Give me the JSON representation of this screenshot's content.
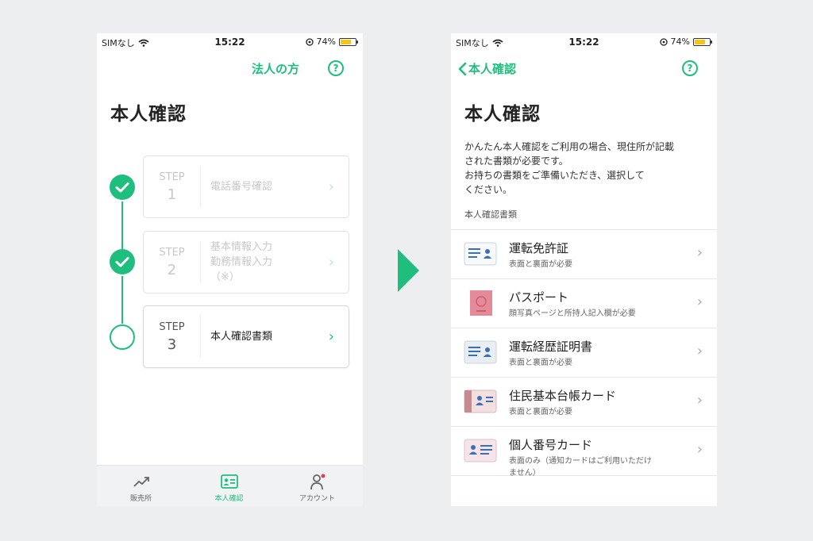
{
  "status": {
    "carrier": "SIMなし",
    "time": "15:22",
    "battery": "74%",
    "battery_level": 0.74,
    "battery_color": "#f5c518"
  },
  "colors": {
    "accent": "#1fbe7f",
    "background": "#eceef0"
  },
  "left": {
    "corporate_link": "法人の方",
    "help": "?",
    "title": "本人確認",
    "steps": [
      {
        "label": "STEP",
        "number": "1",
        "text": "電話番号確認",
        "state": "done"
      },
      {
        "label": "STEP",
        "number": "2",
        "text": "基本情報入力\n勤務情報入力\n（※）",
        "state": "done"
      },
      {
        "label": "STEP",
        "number": "3",
        "text": "本人確認書類",
        "state": "current"
      }
    ],
    "tabs": [
      {
        "label": "販売所",
        "icon": "chart-line-icon"
      },
      {
        "label": "本人確認",
        "icon": "id-card-icon",
        "active": true
      },
      {
        "label": "アカウント",
        "icon": "account-icon"
      }
    ]
  },
  "right": {
    "back_label": "本人確認",
    "help": "?",
    "title": "本人確認",
    "description": "かんたん本人確認をご利用の場合、現住所が記載\nされた書類が必要です。\nお持ちの書類をご準備いただき、選択して\nください。",
    "section_label": "本人確認書類",
    "documents": [
      {
        "name": "運転免許証",
        "sub": "表面と裏面が必要",
        "icon": "drivers-license-icon"
      },
      {
        "name": "パスポート",
        "sub": "顔写真ページと所持人記入欄が必要",
        "icon": "passport-icon"
      },
      {
        "name": "運転経歴証明書",
        "sub": "表面と裏面が必要",
        "icon": "driving-record-icon"
      },
      {
        "name": "住民基本台帳カード",
        "sub": "表面と裏面が必要",
        "icon": "resident-card-icon"
      },
      {
        "name": "個人番号カード",
        "sub": "表面のみ（通知カードはご利用いただけ\nません）",
        "icon": "my-number-card-icon"
      }
    ]
  }
}
